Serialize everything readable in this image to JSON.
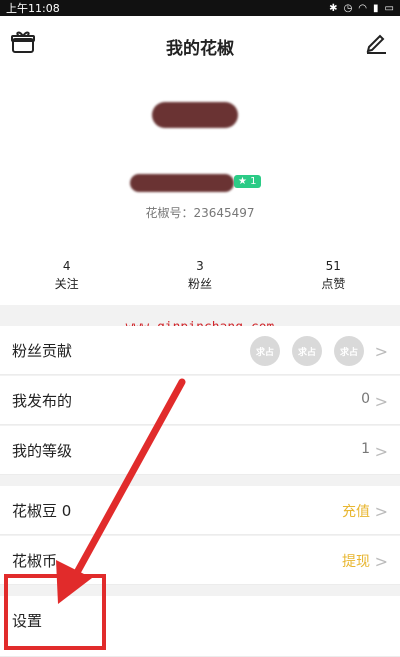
{
  "status": {
    "time": "上午11:08"
  },
  "header": {
    "title": "我的花椒"
  },
  "profile": {
    "level": "★ 1",
    "id_text": "花椒号：23645497"
  },
  "stats": [
    {
      "num": "4",
      "label": "关注"
    },
    {
      "num": "3",
      "label": "粉丝"
    },
    {
      "num": "51",
      "label": "点赞"
    }
  ],
  "watermark": "www.qinpinchang.com",
  "menu": {
    "fans_contrib": {
      "label": "粉丝贡献",
      "badges": [
        "求占",
        "求占",
        "求占"
      ]
    },
    "my_posts": {
      "label": "我发布的",
      "value": "0"
    },
    "my_level": {
      "label": "我的等级",
      "value": "1"
    },
    "beans": {
      "label": "花椒豆 0",
      "action": "充值"
    },
    "coins": {
      "label": "花椒币",
      "action": "提现"
    },
    "settings": {
      "label": "设置"
    }
  },
  "colors": {
    "accent_gold": "#e8b630",
    "annotation_red": "#e12b2b",
    "level_green": "#2bcb86"
  }
}
